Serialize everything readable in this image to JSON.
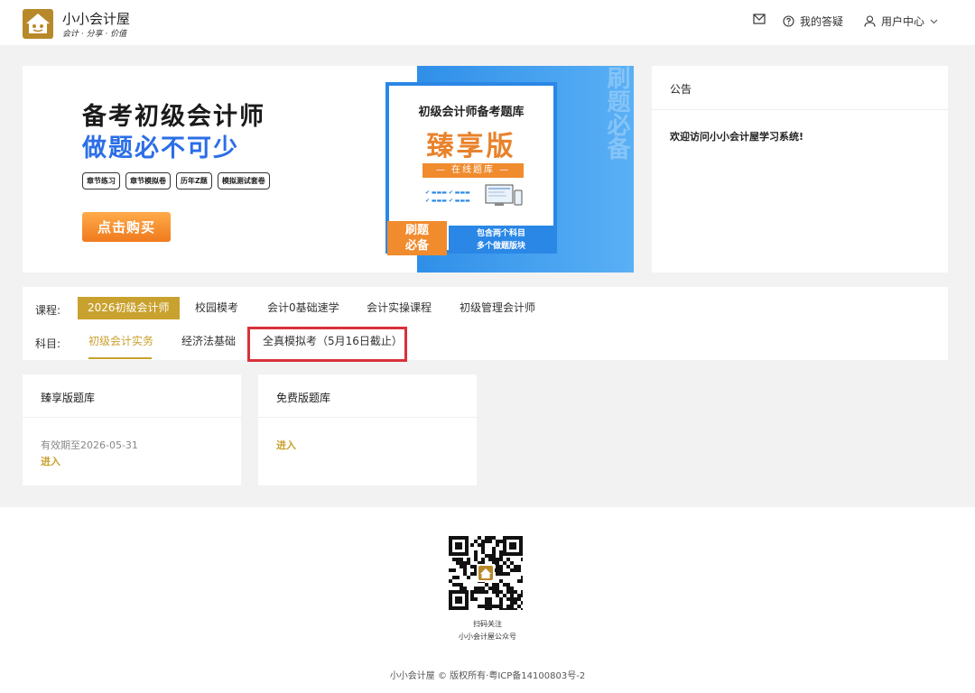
{
  "header": {
    "logo_title": "小小会计屋",
    "logo_subtitle": "会计 · 分享 · 价值",
    "nav": {
      "qa_label": "我的答疑",
      "user_center_label": "用户中心"
    }
  },
  "banner": {
    "headline_1": "备考初级会计师",
    "headline_2": "做题必不可少",
    "tags": [
      "章节练习",
      "章节模拟卷",
      "历年Z题",
      "模拟测试套卷"
    ],
    "buy_label": "点击购买",
    "card_title": "初级会计师备考题库",
    "card_big": "臻享版",
    "card_band": "— 在线题库 —",
    "card_tag_1": "刷题",
    "card_tag_2": "必备",
    "card_foot_1": "包含两个科目",
    "card_foot_2": "多个做题版块",
    "side_text": "刷题必备"
  },
  "notice": {
    "title": "公告",
    "message": "欢迎访问小小会计屋学习系统!"
  },
  "filter": {
    "course_label": "课程:",
    "courses": [
      "2026初级会计师",
      "校园模考",
      "会计0基础速学",
      "会计实操课程",
      "初级管理会计师"
    ],
    "subject_label": "科目:",
    "subjects": [
      "初级会计实务",
      "经济法基础",
      "全真模拟考（5月16日截止）"
    ]
  },
  "cards": [
    {
      "title": "臻享版题库",
      "valid": "有效期至2026-05-31",
      "enter": "进入"
    },
    {
      "title": "免费版题库",
      "enter": "进入"
    }
  ],
  "footer": {
    "qr_line_1": "扫码关注",
    "qr_line_2": "小小会计屋公众号",
    "copyright": "小小会计屋 © 版权所有·粤ICP备14100803号-2"
  },
  "colors": {
    "accent": "#c9a12e",
    "highlight": "#d9313a",
    "banner_blue": "#2a87e6",
    "banner_orange": "#f08b2e"
  }
}
